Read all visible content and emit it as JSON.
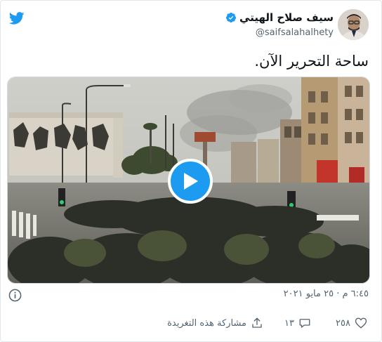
{
  "author": {
    "display_name": "سيف صلاح الهيتي",
    "handle": "@saifsalahalhety",
    "verified": true
  },
  "tweet": {
    "text": "ساحة التحرير الآن.",
    "timestamp": "٦:٤٥ م · ٢٥ مايو ٢٠٢١"
  },
  "actions": {
    "like_count": "٢٥٨",
    "reply_count": "١٣",
    "share_label": "مشاركة هذه التغريدة"
  },
  "colors": {
    "brand": "#1d9bf0",
    "text": "#0f1419",
    "muted": "#536471"
  },
  "icons": {
    "brand": "twitter-bird-icon",
    "verified": "verified-badge-icon",
    "play": "play-icon",
    "info": "info-icon",
    "like": "heart-icon",
    "reply": "speech-bubble-icon",
    "share": "share-icon"
  }
}
